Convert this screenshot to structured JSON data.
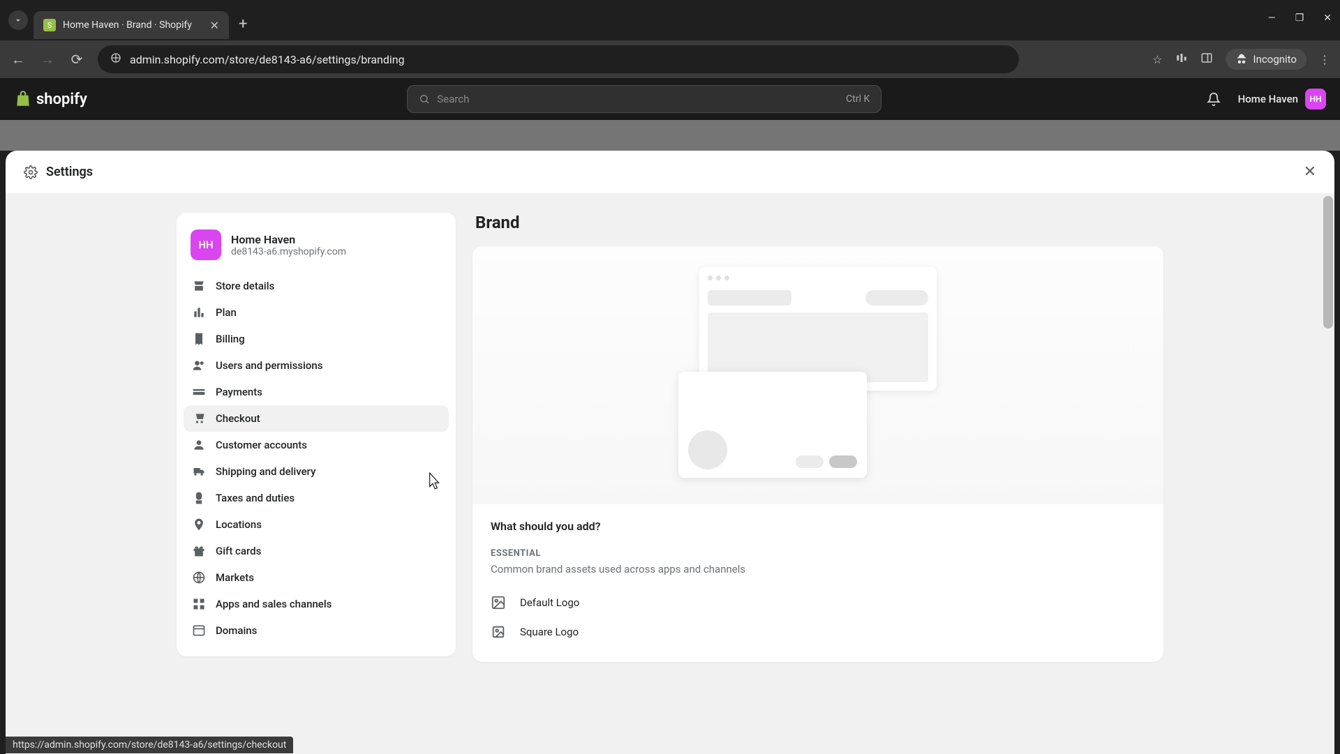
{
  "browser": {
    "tab_title": "Home Haven · Brand · Shopify",
    "url": "admin.shopify.com/store/de8143-a6/settings/branding",
    "incognito_label": "Incognito"
  },
  "header": {
    "logo_text": "shopify",
    "search_placeholder": "Search",
    "search_shortcut": "Ctrl K",
    "store_name": "Home Haven",
    "store_initials": "HH"
  },
  "settings": {
    "title": "Settings",
    "store": {
      "name": "Home Haven",
      "domain": "de8143-a6.myshopify.com",
      "initials": "HH"
    },
    "nav": [
      {
        "label": "Store details"
      },
      {
        "label": "Plan"
      },
      {
        "label": "Billing"
      },
      {
        "label": "Users and permissions"
      },
      {
        "label": "Payments"
      },
      {
        "label": "Checkout"
      },
      {
        "label": "Customer accounts"
      },
      {
        "label": "Shipping and delivery"
      },
      {
        "label": "Taxes and duties"
      },
      {
        "label": "Locations"
      },
      {
        "label": "Gift cards"
      },
      {
        "label": "Markets"
      },
      {
        "label": "Apps and sales channels"
      },
      {
        "label": "Domains"
      }
    ]
  },
  "main": {
    "page_title": "Brand",
    "question": "What should you add?",
    "essential": {
      "label": "ESSENTIAL",
      "desc": "Common brand assets used across apps and channels",
      "items": [
        {
          "label": "Default Logo"
        },
        {
          "label": "Square Logo"
        }
      ]
    }
  },
  "status_url": "https://admin.shopify.com/store/de8143-a6/settings/checkout"
}
